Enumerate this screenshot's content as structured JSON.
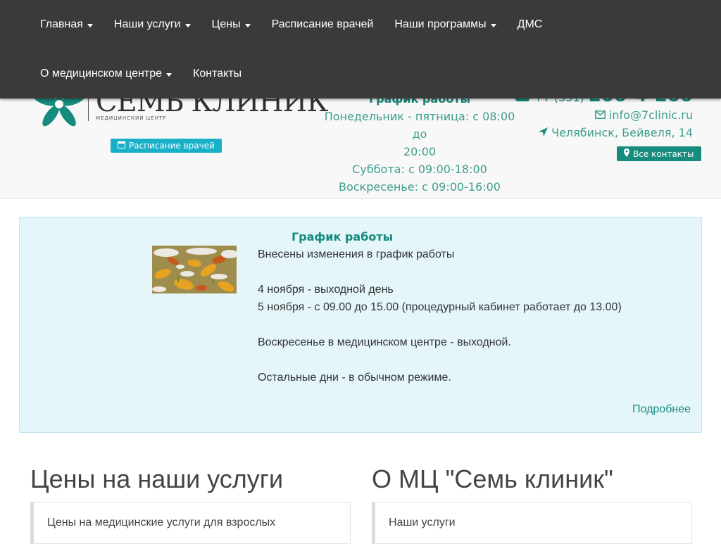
{
  "nav": {
    "row1": [
      {
        "label": "Главная",
        "dropdown": true
      },
      {
        "label": "Наши услуги",
        "dropdown": true
      },
      {
        "label": "Цены",
        "dropdown": true
      },
      {
        "label": "Расписание врачей",
        "dropdown": false
      },
      {
        "label": "Наши программы",
        "dropdown": true
      },
      {
        "label": "ДМС",
        "dropdown": false
      }
    ],
    "row2": [
      {
        "label": "О медицинском центре",
        "dropdown": true
      },
      {
        "label": "Контакты",
        "dropdown": false
      }
    ]
  },
  "header": {
    "logo": {
      "name": "СЕМЬ КЛИНИК",
      "subtitle": "МЕДИЦИНСКИЙ ЦЕНТР"
    },
    "schedule_button": "Расписание врачей",
    "hours": {
      "title": "График работы",
      "weekdays_1": "Понедельник - пятница: с 08:00 до",
      "weekdays_2": "20:00",
      "saturday": "Суббота: с 09:00-18:00",
      "sunday": "Воскресенье: с 09:00-16:00"
    },
    "contacts": {
      "phone_prefix": "+7 (351)",
      "phone_main": "200-4-200",
      "email": "info@7clinic.ru",
      "address": "Челябинск, Бейвеля, 14",
      "all_contacts_button": "Все контакты"
    }
  },
  "notice": {
    "title": "График работы",
    "lines": [
      "Внесены изменения в график работы",
      "",
      "4 ноября - выходной день",
      "5 ноября - с 09.00 до 15.00 (процедурный кабинет работает до 13.00)",
      "",
      "Воскресенье в медицинском центре - выходной.",
      "",
      "Остальные дни - в обычном режиме."
    ],
    "more_link": "Подробнее"
  },
  "sections": {
    "prices": {
      "title": "Цены на наши услуги",
      "first_item": "Цены на медицинские услуги для взрослых"
    },
    "about": {
      "title": "О МЦ \"Семь клиник\"",
      "first_item": "Наши услуги"
    }
  },
  "colors": {
    "navbar": "#3a3a3a",
    "accent": "#168b7e",
    "button_teal": "#17b0c8",
    "notice_bg": "#e5f6fb"
  }
}
